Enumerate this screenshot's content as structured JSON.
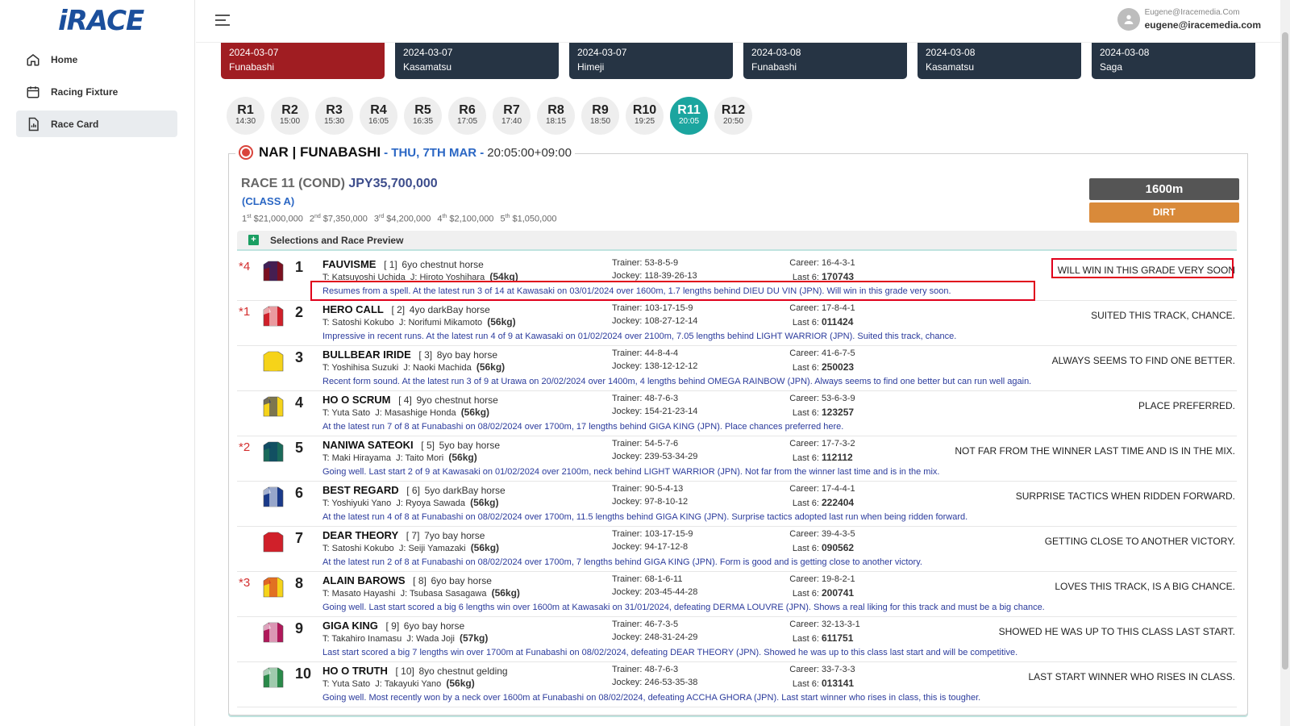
{
  "app": {
    "logo": "iRACE"
  },
  "sidebar": {
    "items": [
      {
        "label": "Home",
        "icon": "home-icon"
      },
      {
        "label": "Racing Fixture",
        "icon": "calendar-icon"
      },
      {
        "label": "Race Card",
        "icon": "document-chart-icon",
        "active": true
      }
    ]
  },
  "user": {
    "display": "Eugene@Iracemedia.Com",
    "email": "eugene@iracemedia.com"
  },
  "meetings": [
    {
      "date": "2024-03-07",
      "venue": "Funabashi",
      "active": true
    },
    {
      "date": "2024-03-07",
      "venue": "Kasamatsu"
    },
    {
      "date": "2024-03-07",
      "venue": "Himeji"
    },
    {
      "date": "2024-03-08",
      "venue": "Funabashi"
    },
    {
      "date": "2024-03-08",
      "venue": "Kasamatsu"
    },
    {
      "date": "2024-03-08",
      "venue": "Saga"
    }
  ],
  "races": [
    {
      "label": "R1",
      "time": "14:30"
    },
    {
      "label": "R2",
      "time": "15:00"
    },
    {
      "label": "R3",
      "time": "15:30"
    },
    {
      "label": "R4",
      "time": "16:05"
    },
    {
      "label": "R5",
      "time": "16:35"
    },
    {
      "label": "R6",
      "time": "17:05"
    },
    {
      "label": "R7",
      "time": "17:40"
    },
    {
      "label": "R8",
      "time": "18:15"
    },
    {
      "label": "R9",
      "time": "18:50"
    },
    {
      "label": "R10",
      "time": "19:25"
    },
    {
      "label": "R11",
      "time": "20:05",
      "active": true
    },
    {
      "label": "R12",
      "time": "20:50"
    }
  ],
  "race_header": {
    "venue": "NAR | FUNABASHI",
    "date": "- THU, 7TH MAR -",
    "time": "20:05:00+09:00",
    "title": "RACE 11 (COND)",
    "prize": "JPY35,700,000",
    "class": "(CLASS A)",
    "prizes": [
      {
        "place": "1",
        "suffix": "st",
        "amount": "$21,000,000"
      },
      {
        "place": "2",
        "suffix": "nd",
        "amount": "$7,350,000"
      },
      {
        "place": "3",
        "suffix": "rd",
        "amount": "$4,200,000"
      },
      {
        "place": "4",
        "suffix": "th",
        "amount": "$2,100,000"
      },
      {
        "place": "5",
        "suffix": "th",
        "amount": "$1,050,000"
      }
    ],
    "distance": "1600m",
    "surface": "DIRT"
  },
  "selections_title": "Selections and Race Preview",
  "runners": [
    {
      "sel": "*4",
      "num": "1",
      "name": "FAUVISME",
      "barrier": "[ 1]",
      "desc": "6yo chestnut horse",
      "trainer_name": "Katsuyoshi Uchida",
      "jockey_name": "Hiroto Yoshihara",
      "weight": "(54kg)",
      "trainer_stats": "53-8-5-9",
      "jockey_stats": "118-39-26-13",
      "career": "16-4-3-1",
      "last6": "170743",
      "tip": "WILL WIN IN THIS GRADE VERY SOON",
      "comment": "Resumes from a spell. At the latest run 3 of 14 at Kawasaki on 03/01/2024 over 1600m, 1.7 lengths behind DIEU DU VIN (JPN). Will win in this grade very soon.",
      "silk_colors": [
        "#7a1020",
        "#1a2a7a"
      ]
    },
    {
      "sel": "*1",
      "num": "2",
      "name": "HERO CALL",
      "barrier": "[ 2]",
      "desc": "4yo darkBay horse",
      "trainer_name": "Satoshi Kokubo",
      "jockey_name": "Norifumi Mikamoto",
      "weight": "(56kg)",
      "trainer_stats": "103-17-15-9",
      "jockey_stats": "108-27-12-14",
      "career": "17-8-4-1",
      "last6": "011424",
      "tip": "SUITED THIS TRACK, CHANCE.",
      "comment": "Impressive in recent runs. At the latest run 4 of 9 at Kawasaki on 01/02/2024 over 2100m, 7.05 lengths behind LIGHT WARRIOR (JPN). Suited this track, chance.",
      "silk_colors": [
        "#d0202a",
        "#ffffff"
      ]
    },
    {
      "sel": "",
      "num": "3",
      "name": "BULLBEAR IRIDE",
      "barrier": "[ 3]",
      "desc": "8yo bay horse",
      "trainer_name": "Yoshihisa Suzuki",
      "jockey_name": "Naoki Machida",
      "weight": "(56kg)",
      "trainer_stats": "44-8-4-4",
      "jockey_stats": "138-12-12-12",
      "career": "41-6-7-5",
      "last6": "250023",
      "tip": "ALWAYS SEEMS TO FIND ONE BETTER.",
      "comment": "Recent form sound. At the latest run 3 of 9 at Urawa on 20/02/2024 over 1400m, 4 lengths behind OMEGA RAINBOW (JPN). Always seems to find one better but can run well again.",
      "silk_colors": [
        "#f5d31a",
        "#f5d31a"
      ]
    },
    {
      "sel": "",
      "num": "4",
      "name": "HO O SCRUM",
      "barrier": "[ 4]",
      "desc": "9yo chestnut horse",
      "trainer_name": "Yuta Sato",
      "jockey_name": "Masashige Honda",
      "weight": "(56kg)",
      "trainer_stats": "48-7-6-3",
      "jockey_stats": "154-21-23-14",
      "career": "53-6-3-9",
      "last6": "123257",
      "tip": "PLACE PREFERRED.",
      "comment": "At the latest run 7 of 8 at Funabashi on 08/02/2024 over 1700m, 17 lengths behind GIGA KING (JPN). Place chances preferred here.",
      "silk_colors": [
        "#f5d31a",
        "#1a2a7a"
      ]
    },
    {
      "sel": "*2",
      "num": "5",
      "name": "NANIWA SATEOKI",
      "barrier": "[ 5]",
      "desc": "5yo bay horse",
      "trainer_name": "Maki Hirayama",
      "jockey_name": "Taito Mori",
      "weight": "(56kg)",
      "trainer_stats": "54-5-7-6",
      "jockey_stats": "239-53-34-29",
      "career": "17-7-3-2",
      "last6": "112112",
      "tip": "NOT FAR FROM THE WINNER LAST TIME AND IS IN THE MIX.",
      "comment": "Going well. Last start 2 of 9 at Kawasaki on 01/02/2024 over 2100m, neck behind LIGHT WARRIOR (JPN). Not far from the winner last time and is in the mix.",
      "silk_colors": [
        "#1a6a5a",
        "#0d3a6a"
      ]
    },
    {
      "sel": "",
      "num": "6",
      "name": "BEST REGARD",
      "barrier": "[ 6]",
      "desc": "5yo darkBay horse",
      "trainer_name": "Yoshiyuki Yano",
      "jockey_name": "Ryoya Sawada",
      "weight": "(56kg)",
      "trainer_stats": "90-5-4-13",
      "jockey_stats": "97-8-10-12",
      "career": "17-4-4-1",
      "last6": "222404",
      "tip": "SURPRISE TACTICS WHEN RIDDEN FORWARD.",
      "comment": "At the latest run 4 of 8 at Funabashi on 08/02/2024 over 1700m, 11.5 lengths behind GIGA KING (JPN). Surprise tactics adopted last run when being ridden forward.",
      "silk_colors": [
        "#1a3a8a",
        "#ffffff"
      ]
    },
    {
      "sel": "",
      "num": "7",
      "name": "DEAR THEORY",
      "barrier": "[ 7]",
      "desc": "7yo bay horse",
      "trainer_name": "Satoshi Kokubo",
      "jockey_name": "Seiji Yamazaki",
      "weight": "(56kg)",
      "trainer_stats": "103-17-15-9",
      "jockey_stats": "94-17-12-8",
      "career": "39-4-3-5",
      "last6": "090562",
      "tip": "GETTING CLOSE TO ANOTHER VICTORY.",
      "comment": "At the latest run 2 of 8 at Funabashi on 08/02/2024 over 1700m, 7 lengths behind GIGA KING (JPN). Form is good and is getting close to another victory.",
      "silk_colors": [
        "#d0202a",
        "#d0202a"
      ]
    },
    {
      "sel": "*3",
      "num": "8",
      "name": "ALAIN BAROWS",
      "barrier": "[ 8]",
      "desc": "6yo bay horse",
      "trainer_name": "Masato Hayashi",
      "jockey_name": "Tsubasa Sasagawa",
      "weight": "(56kg)",
      "trainer_stats": "68-1-6-11",
      "jockey_stats": "203-45-44-28",
      "career": "19-8-2-1",
      "last6": "200741",
      "tip": "LOVES THIS TRACK, IS A BIG CHANCE.",
      "comment": "Going well. Last start scored a big 6 lengths win over 1600m at Kawasaki on 31/01/2024, defeating DERMA LOUVRE (JPN). Shows a real liking for this track and must be a big chance.",
      "silk_colors": [
        "#f5d31a",
        "#d0202a"
      ]
    },
    {
      "sel": "",
      "num": "9",
      "name": "GIGA KING",
      "barrier": "[ 9]",
      "desc": "6yo bay horse",
      "trainer_name": "Takahiro Inamasu",
      "jockey_name": "Wada Joji",
      "weight": "(57kg)",
      "trainer_stats": "46-7-3-5",
      "jockey_stats": "248-31-24-29",
      "career": "32-13-3-1",
      "last6": "611751",
      "tip": "SHOWED HE WAS UP TO THIS CLASS LAST START.",
      "comment": "Last start scored a big 7 lengths win over 1700m at Funabashi on 08/02/2024, defeating DEAR THEORY (JPN). Showed he was up to this class last start and will be competitive.",
      "silk_colors": [
        "#b0185a",
        "#ffffff"
      ]
    },
    {
      "sel": "",
      "num": "10",
      "name": "HO O TRUTH",
      "barrier": "[ 10]",
      "desc": "8yo chestnut gelding",
      "trainer_name": "Yuta Sato",
      "jockey_name": "Takayuki Yano",
      "weight": "(56kg)",
      "trainer_stats": "48-7-6-3",
      "jockey_stats": "246-53-35-38",
      "career": "33-7-3-3",
      "last6": "013141",
      "tip": "LAST START WINNER WHO RISES IN CLASS.",
      "comment": "Going well. Most recently won by a neck over 1600m at Funabashi on 08/02/2024, defeating ACCHA GHORA (JPN). Last start winner who rises in class, this is tougher.",
      "silk_colors": [
        "#2a8a4a",
        "#ffffff"
      ]
    }
  ],
  "labels": {
    "trainer": "Trainer:",
    "jockey": "Jockey:",
    "career": "Career:",
    "last6": "Last 6:",
    "t_prefix": "T:",
    "j_prefix": "J:"
  }
}
